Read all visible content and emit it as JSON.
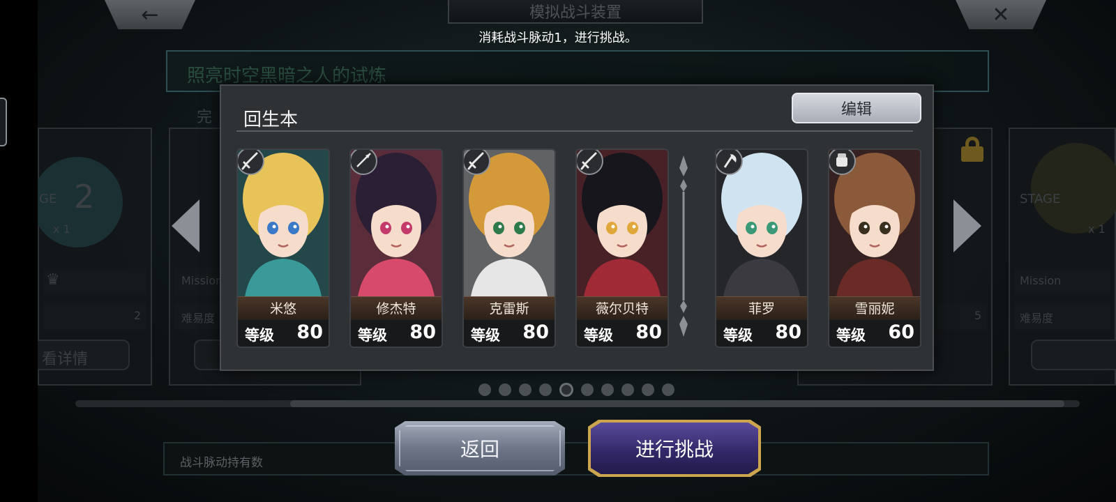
{
  "header": {
    "back_icon": "←",
    "close_icon": "✕",
    "title": "模拟战斗装置",
    "subtitle": "消耗战斗脉动1，进行挑战。"
  },
  "background": {
    "trial_name": "照亮时空黑暗之人的试炼",
    "partial_completed_label": "完",
    "left_card": {
      "stage_partial": "GE",
      "stage_number": "2",
      "multiplier": "x 1",
      "value": "2",
      "details_button": "看详情"
    },
    "mission_label": "Mission",
    "difficulty_label": "难易度",
    "right_card": {
      "stage_label": "STAGE",
      "multiplier_partial": "x 1",
      "value": "5"
    },
    "pulse_count_label": "战斗脉动持有数"
  },
  "dialog": {
    "title": "回生本",
    "edit_button": "编辑",
    "level_label": "等级",
    "members": [
      {
        "name": "米悠",
        "level": "80",
        "class_icon": "sword-icon",
        "hair": "#e8c35a",
        "outfit": "#3a9a9a",
        "eyes": "#3a78c8"
      },
      {
        "name": "修杰特",
        "level": "80",
        "class_icon": "spear-icon",
        "hair": "#2a1f35",
        "outfit": "#d84a6a",
        "eyes": "#c43a6a"
      },
      {
        "name": "克雷斯",
        "level": "80",
        "class_icon": "sword-icon",
        "hair": "#d49a3a",
        "outfit": "#e6e6e6",
        "eyes": "#2f7a4a"
      },
      {
        "name": "薇尔贝特",
        "level": "80",
        "class_icon": "sword-icon",
        "hair": "#16161c",
        "outfit": "#a02a35",
        "eyes": "#e0a83a"
      },
      {
        "name": "菲罗",
        "level": "80",
        "class_icon": "axe-icon",
        "hair": "#cfe3f0",
        "outfit": "#3a3a40",
        "eyes": "#3a9a78"
      },
      {
        "name": "雪丽妮",
        "level": "60",
        "class_icon": "gauntlet-icon",
        "hair": "#8a5a3a",
        "outfit": "#6a2a25",
        "eyes": "#3a3020"
      }
    ]
  },
  "pager": {
    "total": 10,
    "active_index": 4
  },
  "buttons": {
    "return": "返回",
    "challenge": "进行挑战"
  },
  "colors": {
    "gold_border": "#cba64e",
    "challenge_purple": "#34296a",
    "dialog_bg": "#2f3235"
  }
}
